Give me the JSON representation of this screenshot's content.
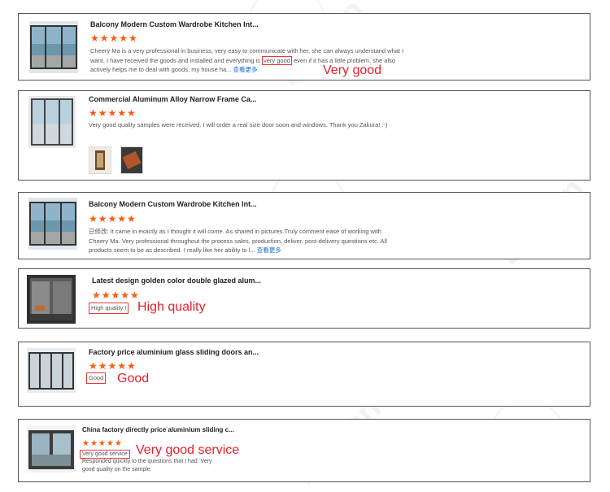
{
  "watermark": "Lemon",
  "reviews": [
    {
      "title": "Balcony Modern Custom Wardrobe Kitchen Int...",
      "stars": "★★★★★",
      "text_before": "Cheery Ma is a very professional in business, very easy to communicate with her, she can always understand what I want, I have received the goods and installed and everything is ",
      "highlight": "very good",
      "text_after": " even if it has a little problem, she also actively helps me to deal with goods, my house ha... ",
      "more": "查看更多",
      "annotation": "Very good"
    },
    {
      "title": "Commercial Aluminum Alloy Narrow Frame Ca...",
      "stars": "★★★★★",
      "text": "Very good quality samples were received. I will order a real size door soon and windows. Thank you Zakura! :-)"
    },
    {
      "title": "Balcony Modern Custom Wardrobe Kitchen Int...",
      "stars": "★★★★★",
      "text": "已修改: It came in exactly as I thought it will come. As shared in pictures.Truly comment ease of working with Cheery Ma. Very professional throughout the process sales, production, deliver, post-delivery questions etc. All products seem to be as described. I really like her ability to l... ",
      "more": "查看更多"
    },
    {
      "title": "Latest design golden color double glazed alum...",
      "stars": "★★★★★",
      "highlight": "High quality !",
      "annotation": "High quality"
    },
    {
      "title": "Factory price aluminium glass sliding doors an...",
      "stars": "★★★★★",
      "highlight": "Good",
      "annotation": "Good"
    },
    {
      "title": "China factory directly price aluminium sliding c...",
      "stars": "★★★★★",
      "highlight": "Very good service",
      "text": "Responded quickly to the questions that I had. Very good quality on the sample.",
      "annotation": "Very good service"
    }
  ]
}
